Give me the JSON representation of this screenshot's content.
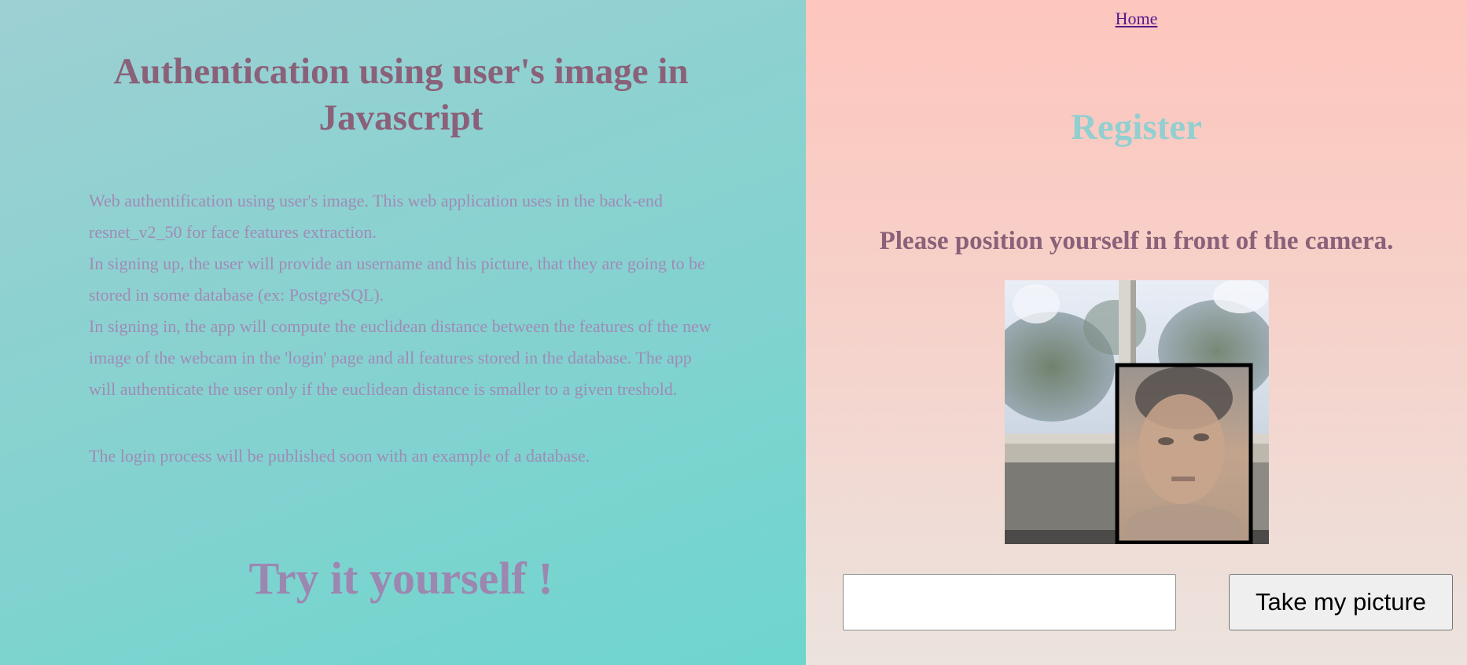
{
  "left_panel": {
    "title": "Authentication using user's image in Javascript",
    "description": [
      "Web authentification using user's image. This web application uses in the back-end resnet_v2_50 for face features extraction.",
      "In signing up, the user will provide an username and his picture, that they are going to be stored in some database (ex: PostgreSQL).",
      "In signing in, the app will compute the euclidean distance between the features of the new image of the webcam in the 'login' page and all features stored in the database. The app will authenticate the user only if the euclidean distance is smaller to a given treshold."
    ],
    "note": "The login process will be published soon with an example of a database.",
    "cta": "Try it yourself !"
  },
  "right_panel": {
    "home_link": "Home",
    "heading": "Register",
    "instruction": "Please position yourself in front of the camera.",
    "username_input": {
      "value": "",
      "placeholder": ""
    },
    "take_picture_button": "Take my picture"
  },
  "colors": {
    "left_bg_top": "#9dd0d3",
    "left_bg_bottom": "#6ed6cd",
    "right_bg_top": "#fdc6be",
    "right_bg_bottom": "#ece3de",
    "title_color": "#8a6179",
    "body_text_color": "#a08bb5",
    "register_color": "#93cfd0",
    "link_color": "#551a8b"
  }
}
